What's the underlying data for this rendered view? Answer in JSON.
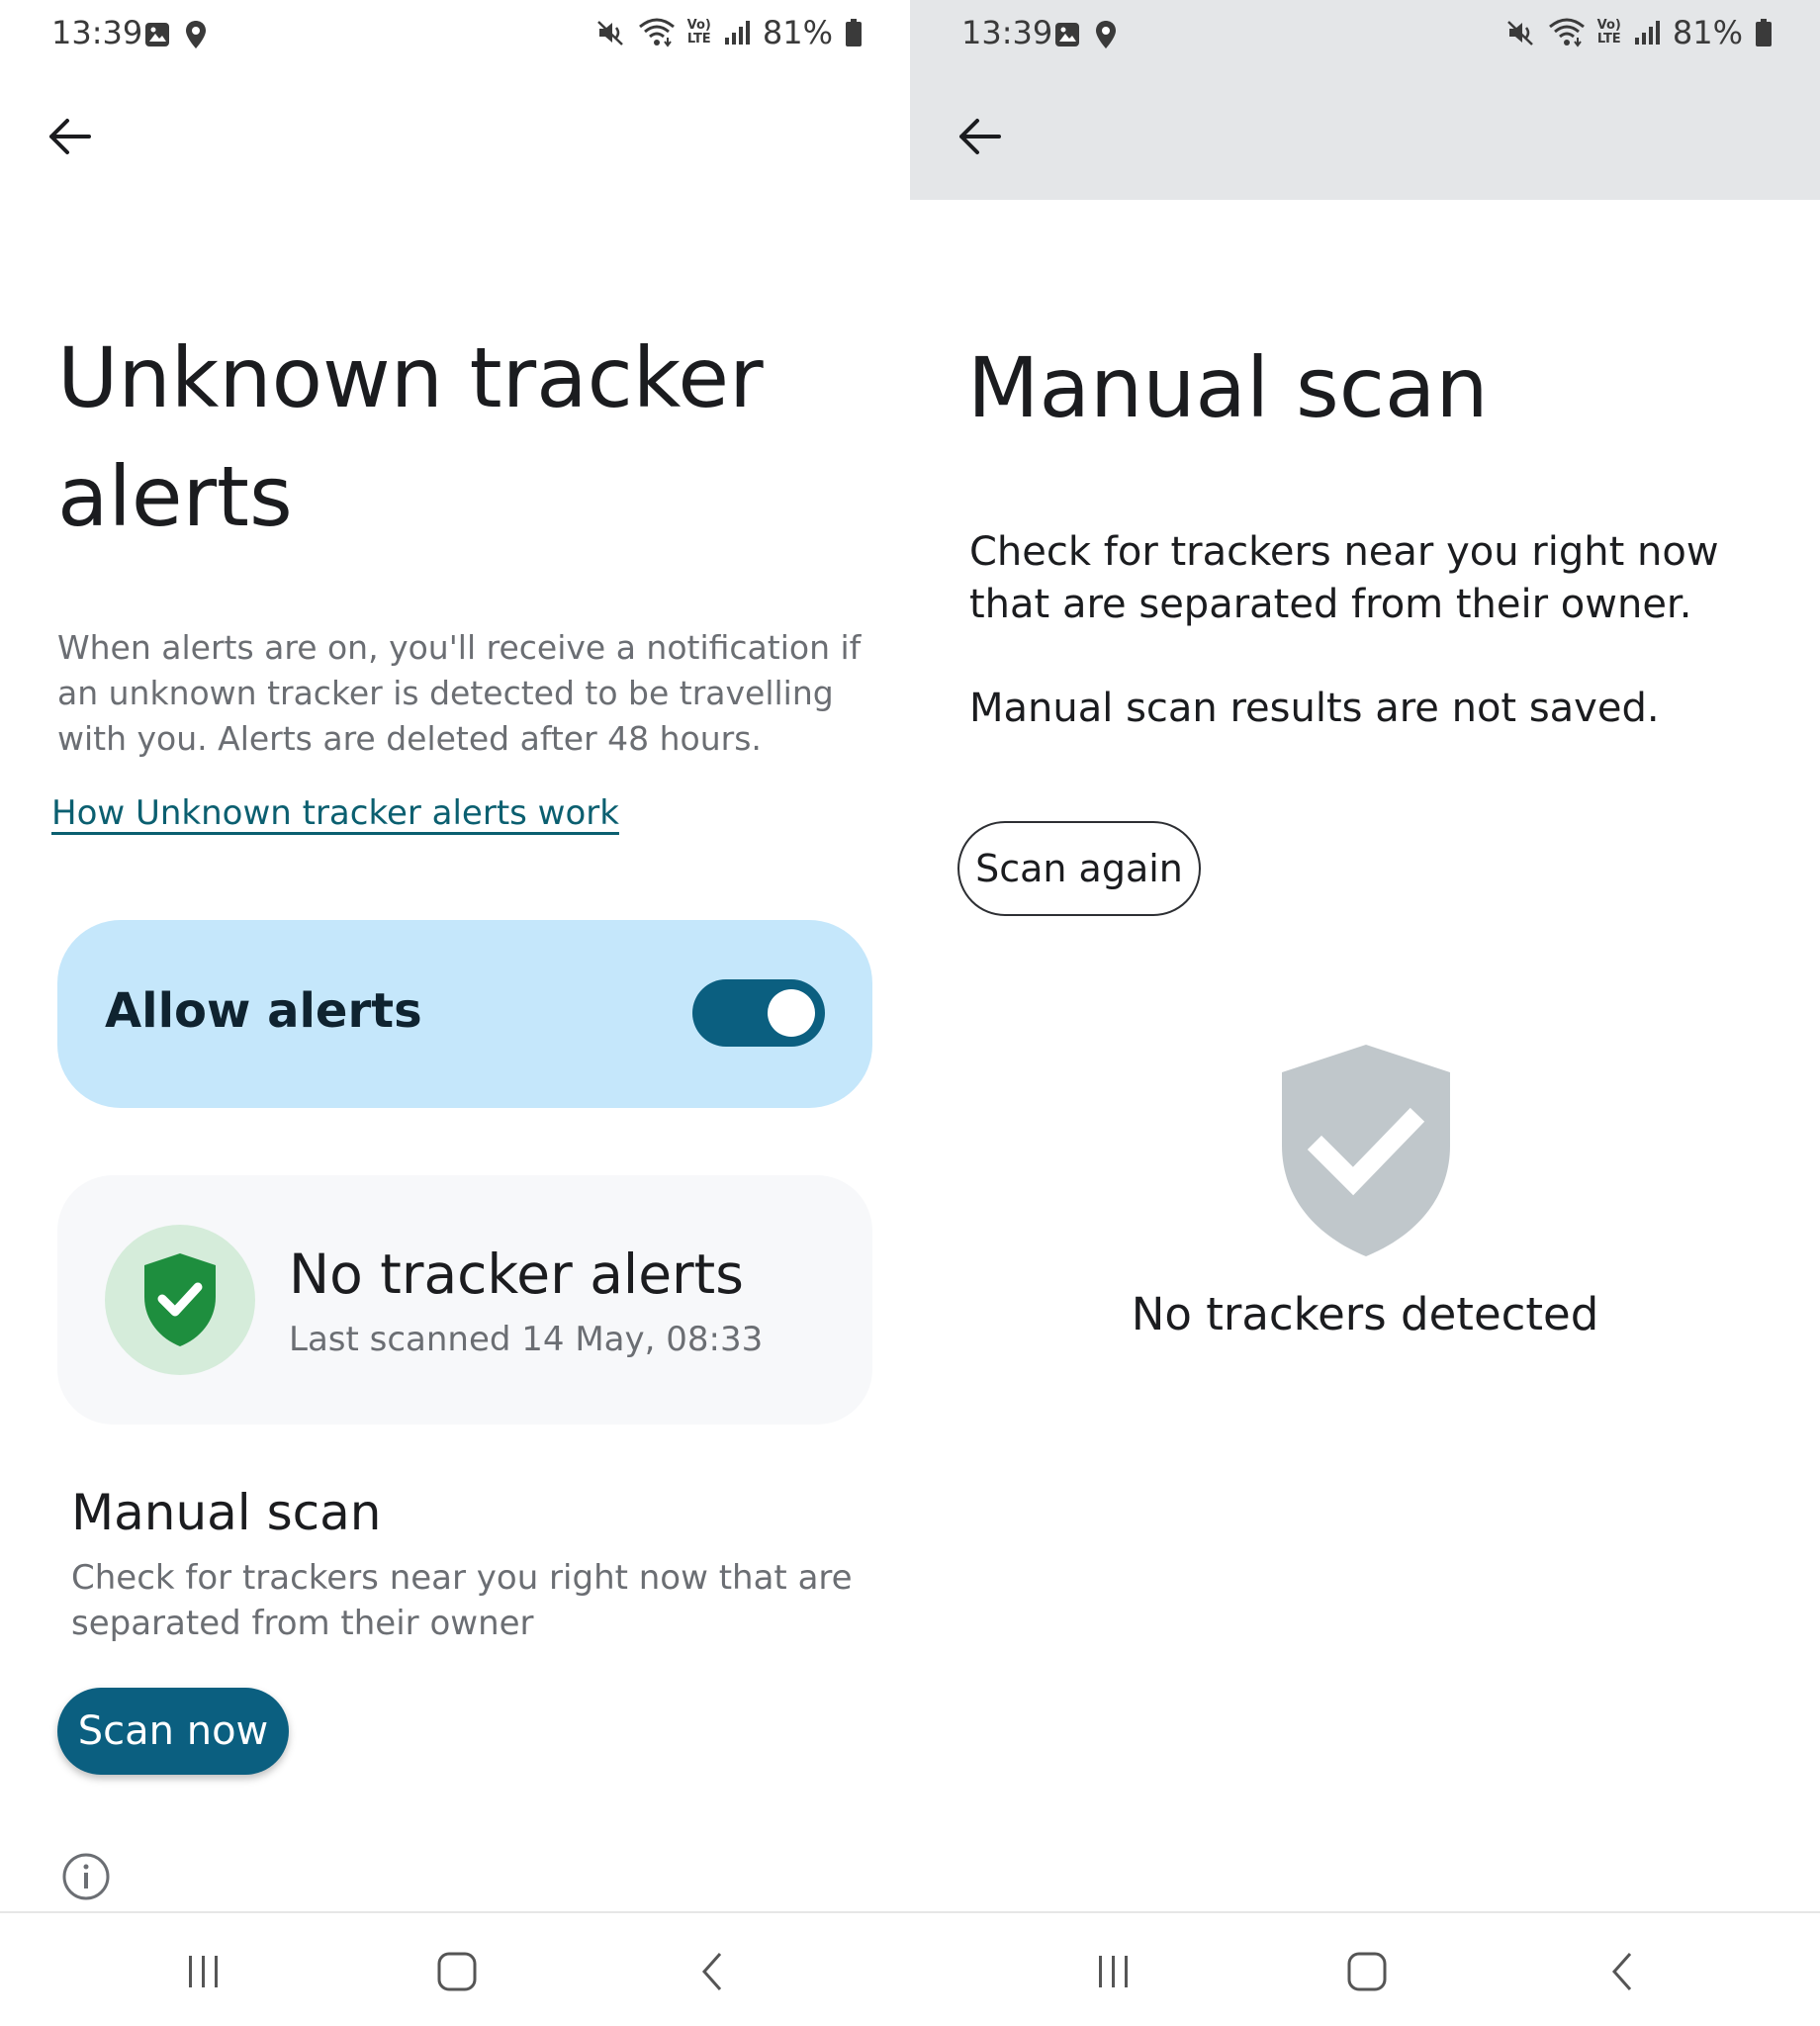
{
  "colors": {
    "accent": "#0b5f80",
    "link": "#0b5f70",
    "allow_card_bg": "#c5e7fb",
    "status_card_bg": "#f7f8fa",
    "shield_green": "#1e8e3e",
    "shield_green_bg": "#d5ecda",
    "shield_grey": "#c0c7cb",
    "appbar_grey": "#e4e6e8"
  },
  "status_bar": {
    "time": "13:39",
    "battery": "81%",
    "icons_left": [
      "gallery-icon",
      "location-icon"
    ],
    "icons_right": [
      "mute-icon",
      "wifi-icon",
      "volte-icon",
      "signal-icon",
      "battery-icon"
    ],
    "volte_top": "Vo)",
    "volte_bottom": "LTE"
  },
  "left_screen": {
    "back_icon": "arrow-back-icon",
    "title": "Unknown tracker alerts",
    "description": "When alerts are on, you'll receive a notification if an unknown tracker is detected to be travelling with you. Alerts are deleted after 48 hours.",
    "help_link": "How Unknown tracker alerts work",
    "allow_alerts": {
      "label": "Allow alerts",
      "enabled": true
    },
    "status_card": {
      "icon": "shield-check-icon",
      "title": "No tracker alerts",
      "subtitle": "Last scanned 14 May, 08:33"
    },
    "manual_scan": {
      "heading": "Manual scan",
      "description": "Check for trackers near you right now that are separated from their owner",
      "button": "Scan now"
    },
    "info_icon": "info-icon"
  },
  "right_screen": {
    "back_icon": "arrow-back-icon",
    "title": "Manual scan",
    "description": "Check for trackers near you right now that are separated from their owner.",
    "note": "Manual scan results are not saved.",
    "button": "Scan again",
    "result_icon": "shield-check-icon",
    "result_text": "No trackers detected"
  },
  "nav_bar": {
    "items": [
      "recents-icon",
      "home-icon",
      "back-icon"
    ]
  }
}
